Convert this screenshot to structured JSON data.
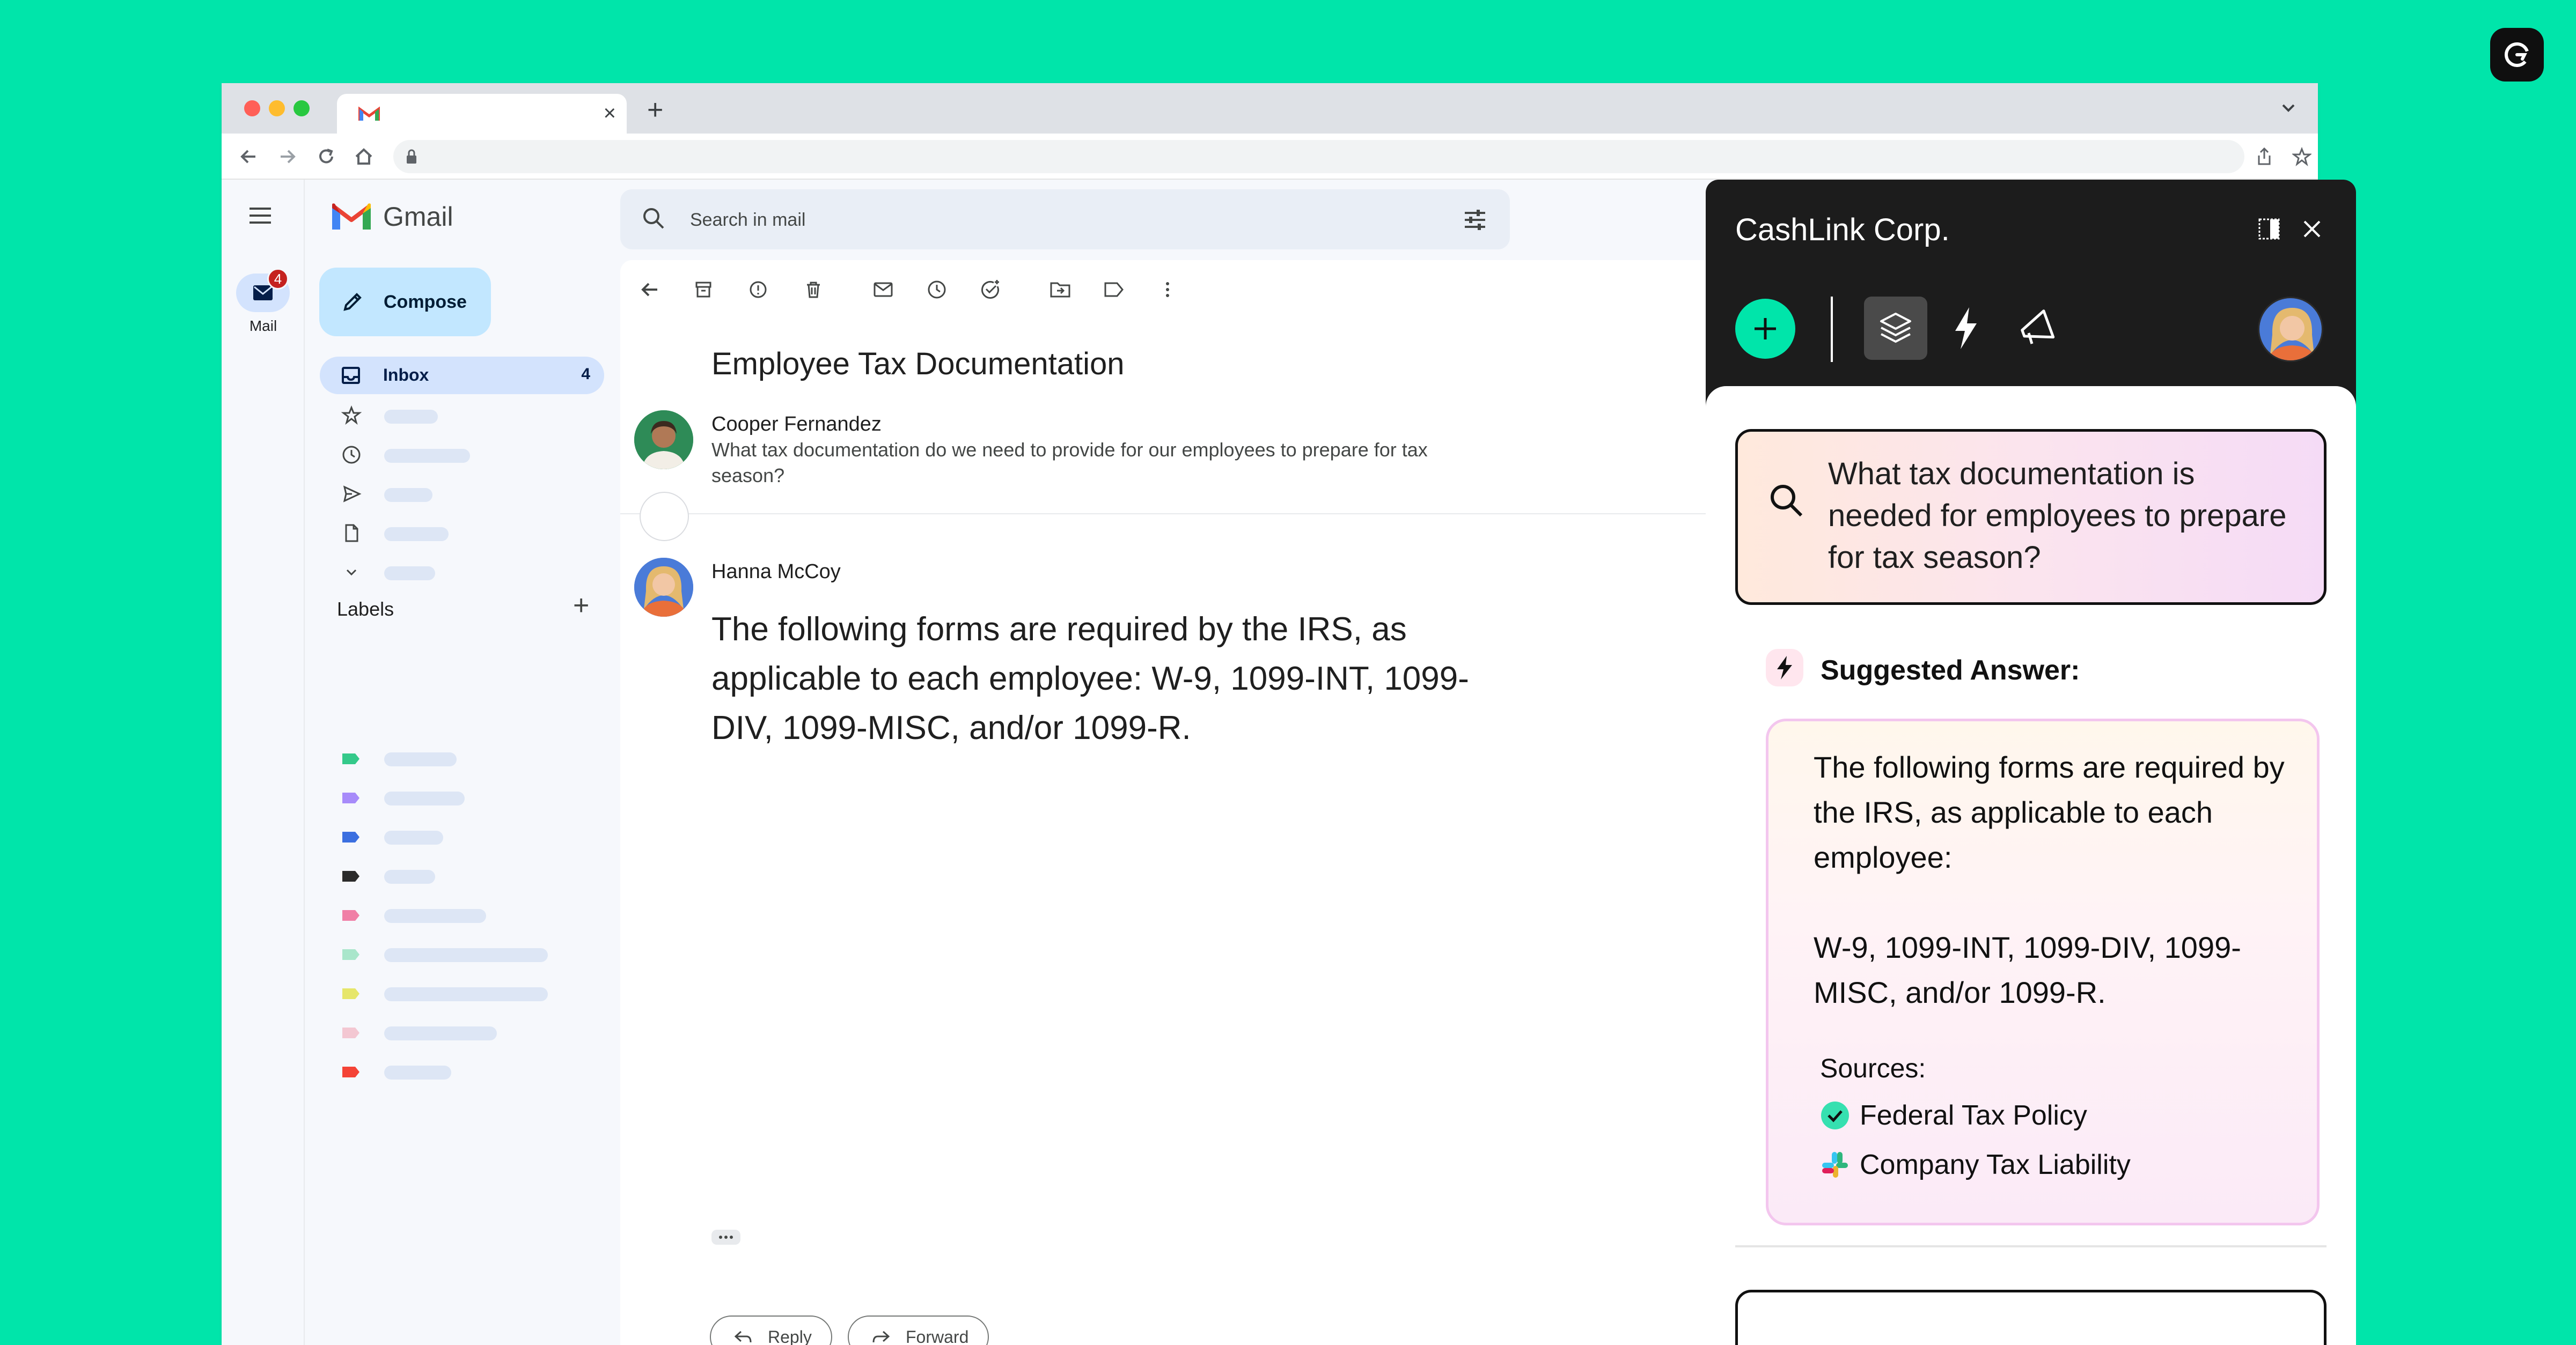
{
  "browser": {
    "tab_title": "",
    "url": ""
  },
  "gmail": {
    "app_name": "Gmail",
    "rail": {
      "mail_label": "Mail",
      "mail_badge": "4"
    },
    "compose_label": "Compose",
    "inbox": {
      "label": "Inbox",
      "count": "4"
    },
    "labels_title": "Labels",
    "search_placeholder": "Search in mail",
    "email": {
      "subject": "Employee Tax Documentation",
      "message1": {
        "sender": "Cooper Fernandez",
        "snippet": "What tax documentation do we need to provide for our employees to prepare for tax season?"
      },
      "message2": {
        "sender": "Hanna McCoy",
        "body": "The following forms are required by the IRS, as applicable to each employee: W-9, 1099-INT, 1099-DIV, 1099-MISC, and/or 1099-R."
      },
      "reply_label": "Reply",
      "forward_label": "Forward"
    }
  },
  "panel": {
    "title": "CashLink Corp.",
    "query": "What tax documentation is needed for employees to prepare for tax season?",
    "suggested_title": "Suggested Answer:",
    "answer_intro": "The following forms are required by the IRS, as applicable to each employee:",
    "answer_forms": "W-9, 1099-INT, 1099-DIV, 1099-MISC, and/or 1099-R.",
    "sources_title": "Sources:",
    "sources": [
      {
        "label": "Federal Tax Policy",
        "icon": "check-circle-icon"
      },
      {
        "label": "Company Tax Liability",
        "icon": "slack-icon"
      }
    ]
  },
  "colors": {
    "background": "#00E5AA",
    "accent": "#00E5AA",
    "panel_dark": "#1c1c1c",
    "compose_bg": "#C2E7FF",
    "inbox_bg": "#D3E3FD",
    "badge_red": "#C5221F"
  }
}
